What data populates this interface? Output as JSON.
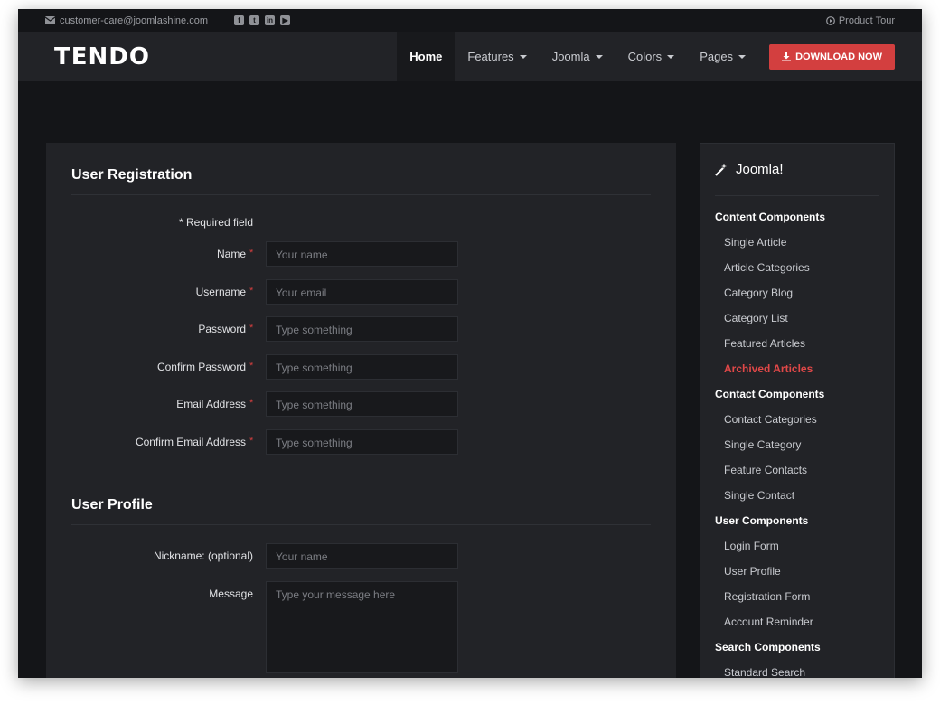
{
  "topbar": {
    "email": "customer-care@joomlashine.com",
    "social_icons": [
      "facebook-icon",
      "twitter-icon",
      "linkedin-icon",
      "youtube-icon"
    ],
    "product_tour": "Product Tour"
  },
  "nav": {
    "logo": "TENDO",
    "items": [
      {
        "label": "Home",
        "active": true
      },
      {
        "label": "Features",
        "dropdown": true
      },
      {
        "label": "Joomla",
        "dropdown": true
      },
      {
        "label": "Colors",
        "dropdown": true
      },
      {
        "label": "Pages",
        "dropdown": true
      }
    ],
    "download_label": "DOWNLOAD NOW"
  },
  "registration": {
    "title": "User Registration",
    "required_note": "* Required field",
    "fields": [
      {
        "label": "Name",
        "placeholder": "Your name",
        "required": true
      },
      {
        "label": "Username",
        "placeholder": "Your email",
        "required": true
      },
      {
        "label": "Password",
        "placeholder": "Type something",
        "required": true
      },
      {
        "label": "Confirm Password",
        "placeholder": "Type something",
        "required": true
      },
      {
        "label": "Email Address",
        "placeholder": "Type something",
        "required": true
      },
      {
        "label": "Confirm Email Address",
        "placeholder": "Type something",
        "required": true
      }
    ]
  },
  "profile": {
    "title": "User Profile",
    "nickname_label": "Nickname: (optional)",
    "nickname_placeholder": "Your name",
    "message_label": "Message",
    "message_placeholder": "Type your message here"
  },
  "sidebar": {
    "title": "Joomla!",
    "groups": [
      {
        "heading": "Content Components",
        "links": [
          "Single Article",
          "Article Categories",
          "Category Blog",
          "Category List",
          "Featured Articles",
          "Archived Articles"
        ]
      },
      {
        "heading": "Contact Components",
        "links": [
          "Contact Categories",
          "Single Category",
          "Feature Contacts",
          "Single Contact"
        ]
      },
      {
        "heading": "User Components",
        "links": [
          "Login Form",
          "User Profile",
          "Registration Form",
          "Account Reminder"
        ]
      },
      {
        "heading": "Search Components",
        "links": [
          "Standard Search"
        ]
      }
    ],
    "active_link": "Archived Articles"
  },
  "colors": {
    "accent": "#d33f3f",
    "background": "#141518",
    "card": "#222327"
  }
}
